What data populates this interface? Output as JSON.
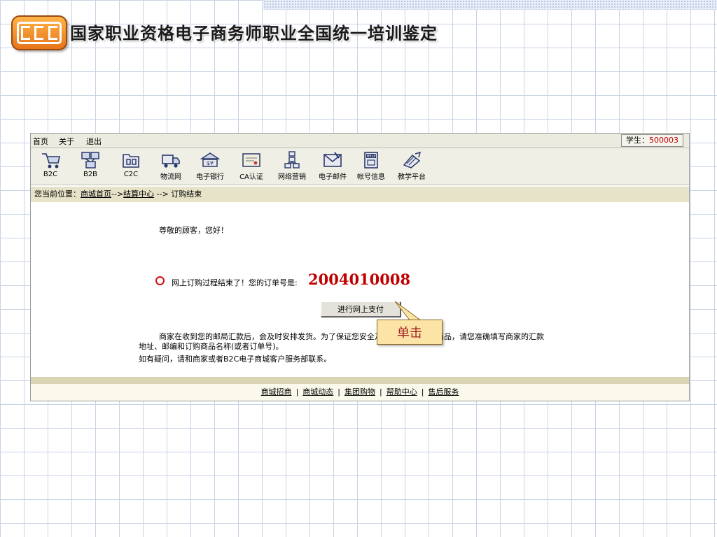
{
  "slide": {
    "title": "国家职业资格电子商务师职业全国统一培训鉴定",
    "logo_icon": "elp-logo",
    "accent_color": "#e6761a"
  },
  "menubar": {
    "items": [
      "首页",
      "关于",
      "退出"
    ],
    "student_label": "学生：",
    "student_id": "500003"
  },
  "toolbar": {
    "items": [
      {
        "label": "B2C",
        "icon": "shopping-cart-icon"
      },
      {
        "label": "B2B",
        "icon": "network-icon"
      },
      {
        "label": "C2C",
        "icon": "folder-icon"
      },
      {
        "label": "物流网",
        "icon": "truck-icon"
      },
      {
        "label": "电子银行",
        "icon": "bank-icon"
      },
      {
        "label": "CA认证",
        "icon": "certificate-icon"
      },
      {
        "label": "网络营销",
        "icon": "org-chart-icon"
      },
      {
        "label": "电子邮件",
        "icon": "mail-icon"
      },
      {
        "label": "帐号信息",
        "icon": "help-book-icon"
      },
      {
        "label": "教学平台",
        "icon": "teaching-icon"
      }
    ]
  },
  "breadcrumb": {
    "prefix": "您当前位置：",
    "home": "商城首页",
    "sep1": "-->",
    "checkout": "结算中心",
    "sep2": " -->",
    "current": " 订购结束"
  },
  "content": {
    "greeting": "尊敬的顾客，您好！",
    "order_text": "网上订购过程结束了！您的订单号是:",
    "order_number": "2004010008",
    "pay_button": "进行网上支付",
    "info_line1": "商家在收到您的邮局汇款后，会及时安排发货。为了保证您安全及时地收到所订购商品，请您准确填写商家的汇款",
    "info_line2": "地址、邮编和订购商品名称(或者订单号)。",
    "info_line3": "如有疑问，请和商家或者B2C电子商城客户服务部联系。",
    "callout": "单击"
  },
  "footer": {
    "links": [
      "商城招商",
      "商城动态",
      "集团购物",
      "帮助中心",
      "售后服务"
    ],
    "separator": "|"
  }
}
